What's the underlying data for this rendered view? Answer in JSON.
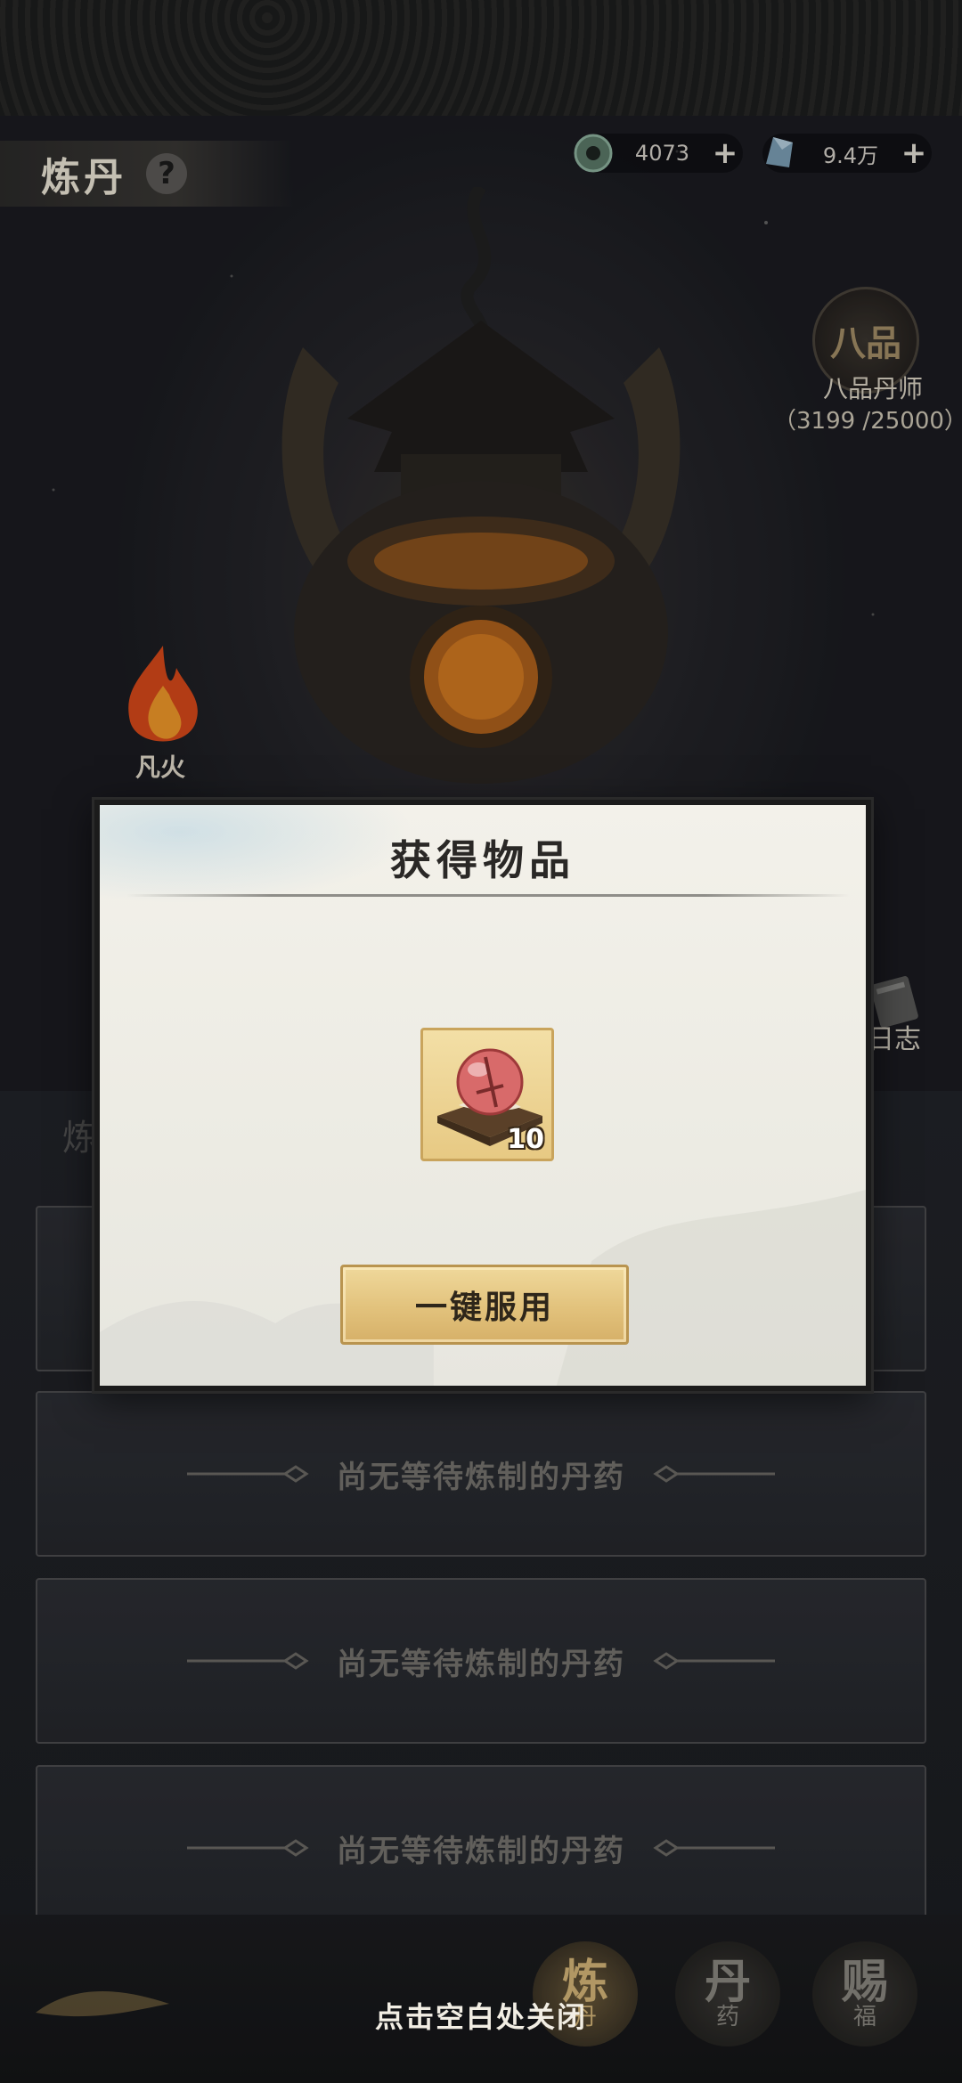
{
  "header": {
    "title": "炼丹",
    "help_label": "?",
    "currencies": [
      {
        "icon": "jade-coin-icon",
        "value": "4073",
        "plus": "+"
      },
      {
        "icon": "spirit-stone-icon",
        "value": "9.4万",
        "plus": "+"
      }
    ]
  },
  "rank": {
    "badge": "八品",
    "title": "八品丹师",
    "progress": "（3199 /25000）"
  },
  "fire": {
    "icon": "flame-icon",
    "label": "凡火"
  },
  "log": {
    "icon": "book-icon",
    "label": "日志"
  },
  "side_tab": "炼",
  "queue": {
    "empty_text": "尚无等待炼制的丹药",
    "rows": [
      {
        "text": "尚无等待炼制的丹药"
      },
      {
        "text": "尚无等待炼制的丹药"
      },
      {
        "text": "尚无等待炼制的丹药"
      }
    ]
  },
  "modal": {
    "title": "获得物品",
    "item": {
      "icon": "elixir-pill-icon",
      "count": "10"
    },
    "use_button": "一键服用"
  },
  "bottom_nav": {
    "items": [
      {
        "big": "炼",
        "small": "丹",
        "active": true
      },
      {
        "big": "丹",
        "small": "药",
        "active": false
      },
      {
        "big": "赐",
        "small": "福",
        "active": false
      }
    ]
  },
  "close_hint": "点击空白处关闭"
}
